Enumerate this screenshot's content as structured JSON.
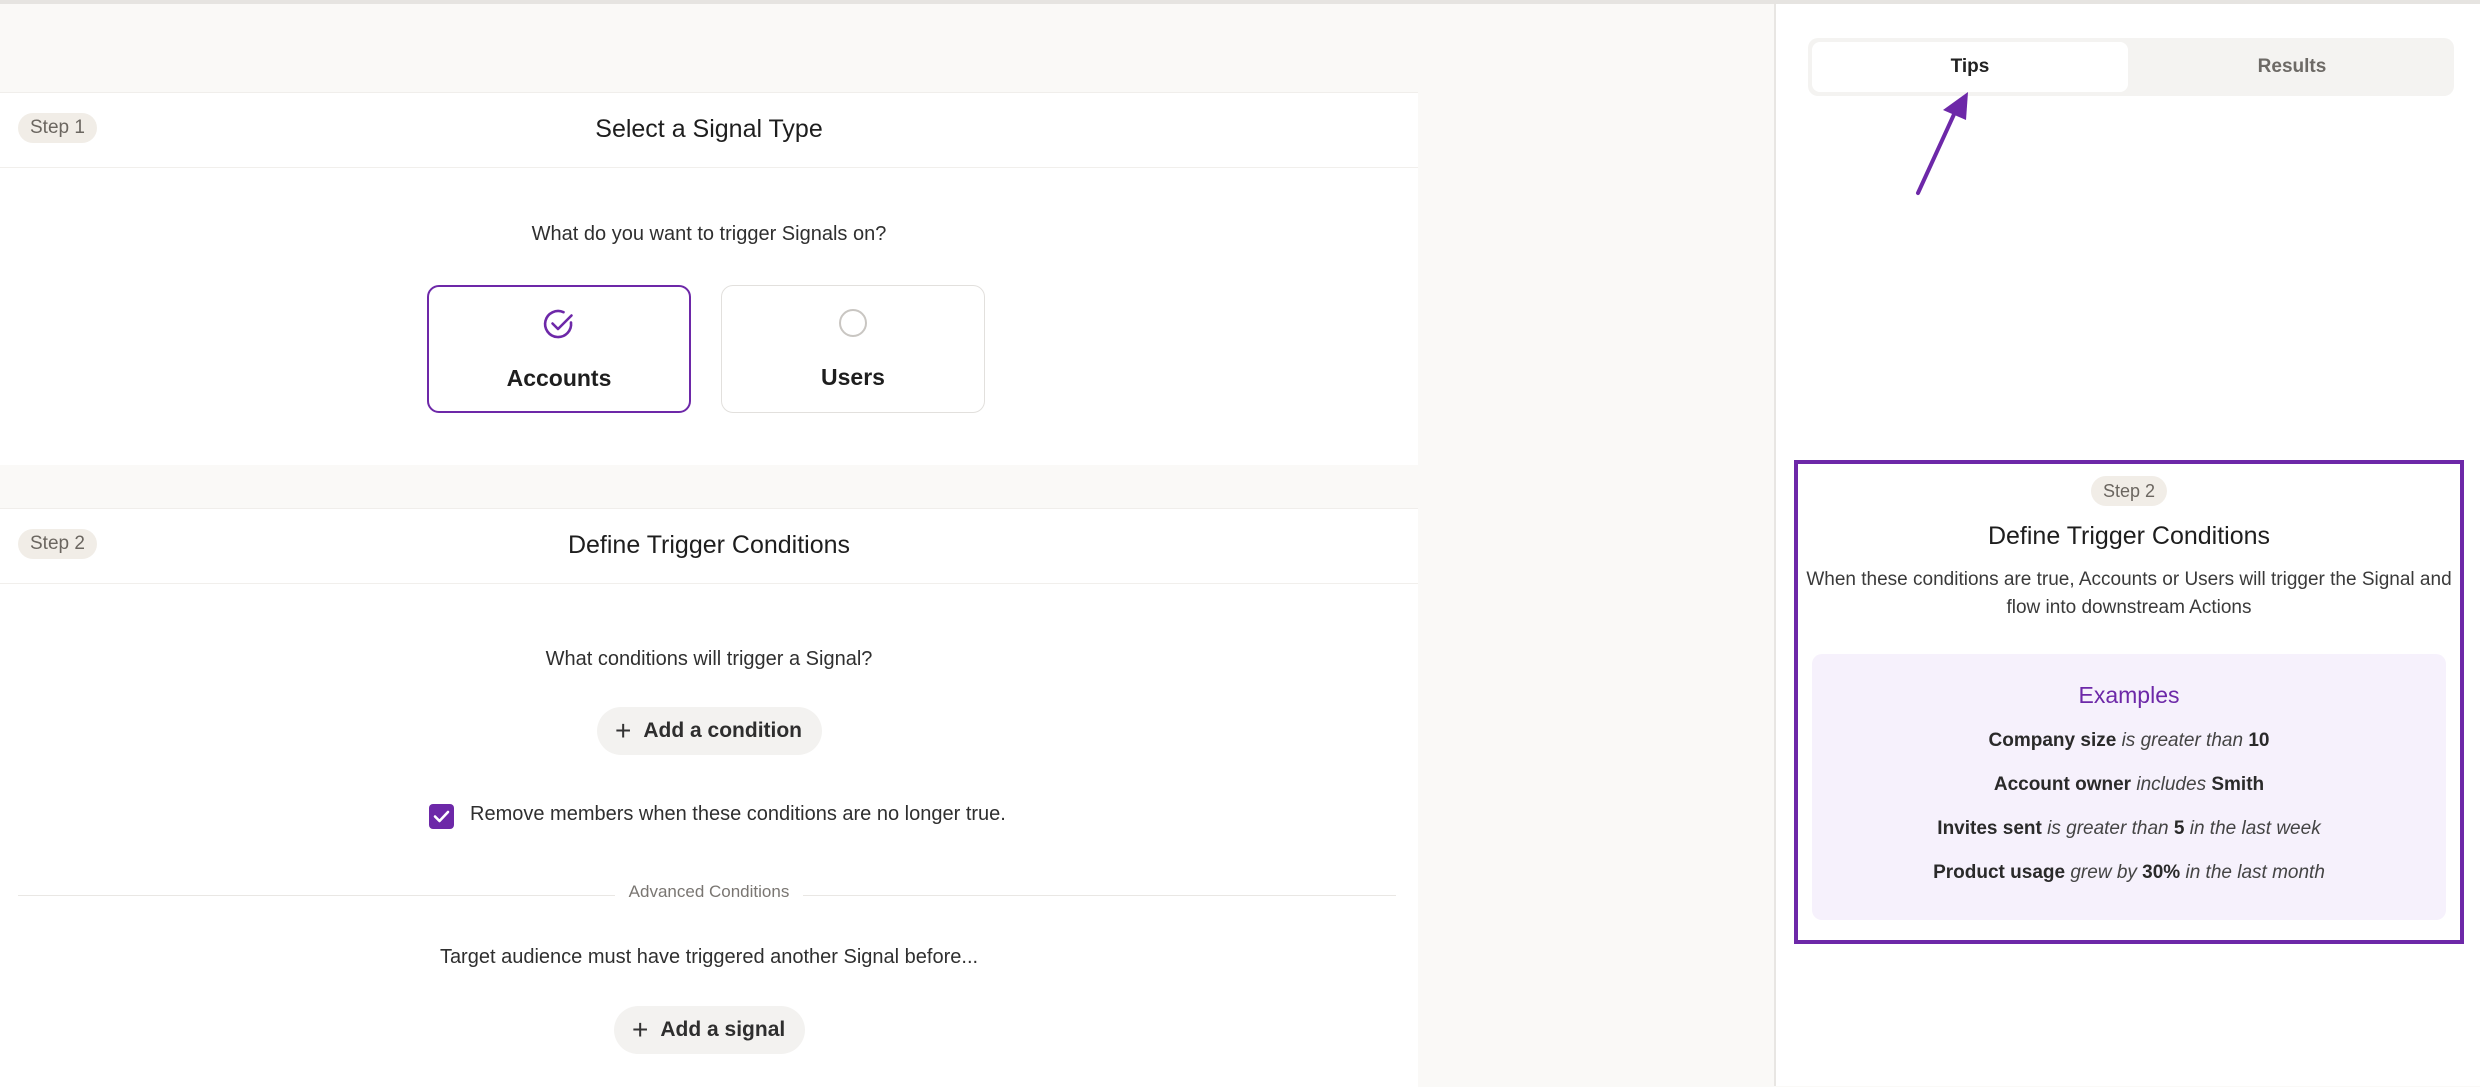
{
  "colors": {
    "accent": "#6d28a8",
    "examples_bg": "#f6f1fc",
    "badge_bg": "#f1ede7"
  },
  "step1": {
    "badge": "Step 1",
    "title": "Select a Signal Type",
    "question": "What do you want to trigger Signals on?",
    "options": [
      {
        "label": "Accounts",
        "selected": true,
        "icon": "check-circle-icon"
      },
      {
        "label": "Users",
        "selected": false,
        "icon": "empty-circle-icon"
      }
    ]
  },
  "step2": {
    "badge": "Step 2",
    "title": "Define Trigger Conditions",
    "question": "What conditions will trigger a Signal?",
    "add_condition_label": "Add a condition",
    "remove_members_label": "Remove members when these conditions are no longer true.",
    "remove_members_checked": true,
    "advanced_label": "Advanced Conditions",
    "audience_text": "Target audience must have triggered another Signal before...",
    "add_signal_label": "Add a signal"
  },
  "sidepanel": {
    "tabs": [
      {
        "label": "Tips",
        "active": true
      },
      {
        "label": "Results",
        "active": false
      }
    ],
    "tip": {
      "badge": "Step 2",
      "title": "Define Trigger Conditions",
      "description": "When these conditions are true, Accounts or Users will trigger the Signal and flow into downstream Actions",
      "examples_title": "Examples",
      "examples": [
        {
          "field": "Company size",
          "op": "is greater than",
          "value": "10",
          "suffix": ""
        },
        {
          "field": "Account owner",
          "op": "includes",
          "value": "Smith",
          "suffix": ""
        },
        {
          "field": "Invites sent",
          "op": "is greater than",
          "value": "5",
          "suffix": "in the last week"
        },
        {
          "field": "Product usage",
          "op": "grew by",
          "value": "30%",
          "suffix": "in the last month"
        }
      ]
    }
  }
}
